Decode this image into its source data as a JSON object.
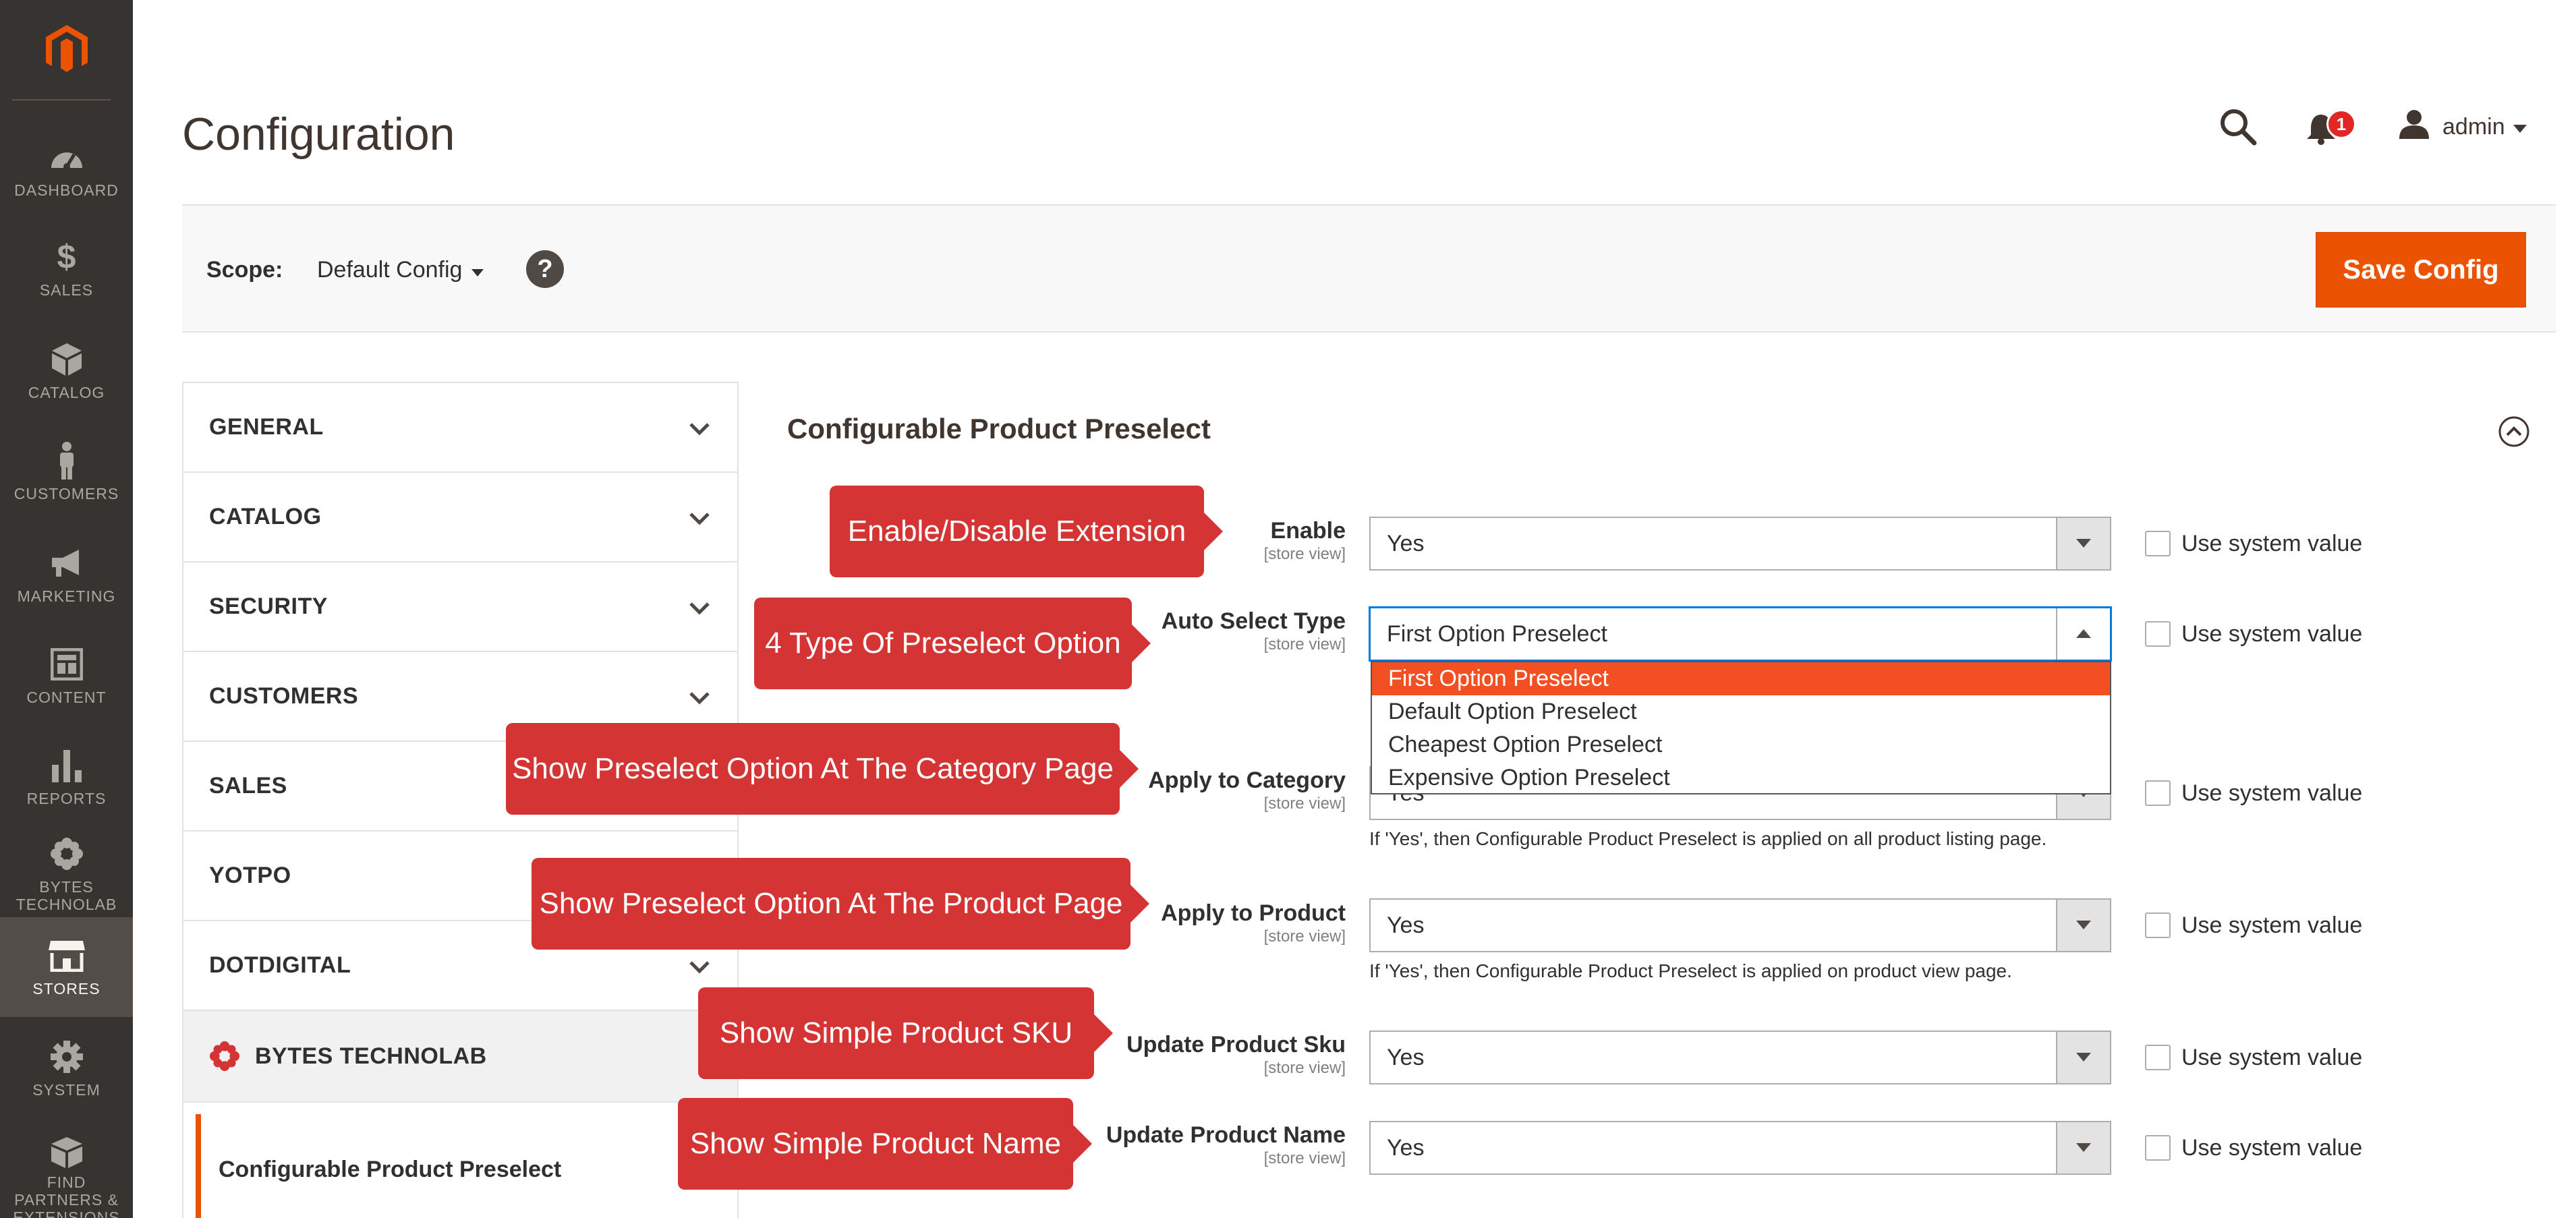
{
  "brand": {
    "accent": "#eb5202",
    "menu_bg": "#373330",
    "callout_color": "#d43434"
  },
  "menu": {
    "items": [
      {
        "label": "DASHBOARD",
        "icon": "dashboard-icon"
      },
      {
        "label": "SALES",
        "icon": "dollar-icon"
      },
      {
        "label": "CATALOG",
        "icon": "box-icon"
      },
      {
        "label": "CUSTOMERS",
        "icon": "person-icon"
      },
      {
        "label": "MARKETING",
        "icon": "megaphone-icon"
      },
      {
        "label": "CONTENT",
        "icon": "layout-icon"
      },
      {
        "label": "REPORTS",
        "icon": "bar-chart-icon"
      },
      {
        "label": "BYTES TECHNOLAB",
        "icon": "gear-flower-icon"
      },
      {
        "label": "STORES",
        "icon": "store-icon",
        "active": true
      },
      {
        "label": "SYSTEM",
        "icon": "gear-icon"
      },
      {
        "label": "FIND PARTNERS & EXTENSIONS",
        "icon": "cubes-icon"
      }
    ]
  },
  "header": {
    "title": "Configuration",
    "notifications_count": "1",
    "user": "admin"
  },
  "scope": {
    "label": "Scope:",
    "value": "Default Config",
    "help": "?",
    "save_label": "Save Config"
  },
  "tabs": {
    "general": "GENERAL",
    "catalog": "CATALOG",
    "security": "SECURITY",
    "customers": "CUSTOMERS",
    "sales": "SALES",
    "yotpo": "YOTPO",
    "dotdigital": "DOTDIGITAL",
    "bytes": "BYTES TECHNOLAB",
    "bytes_sub": "Configurable Product Preselect"
  },
  "section": {
    "title": "Configurable Product Preselect",
    "scope_note": "[store view]",
    "use_system": "Use system value",
    "fields": {
      "enable": {
        "label": "Enable",
        "value": "Yes"
      },
      "auto_select": {
        "label": "Auto Select Type",
        "value": "First Option Preselect"
      },
      "apply_category": {
        "label": "Apply to Category",
        "value": "Yes",
        "note": "If 'Yes', then Configurable Product Preselect is applied on all product listing page."
      },
      "apply_product": {
        "label": "Apply to Product",
        "value": "Yes",
        "note": "If 'Yes', then Configurable Product Preselect is applied on product view page."
      },
      "update_sku": {
        "label": "Update Product Sku",
        "value": "Yes"
      },
      "update_name": {
        "label": "Update Product Name",
        "value": "Yes"
      }
    },
    "dropdown_options": [
      "First Option Preselect",
      "Default Option Preselect",
      "Cheapest Option Preselect",
      "Expensive Option Preselect"
    ]
  },
  "callouts": {
    "enable": "Enable/Disable Extension",
    "auto_select": "4 Type Of Preselect Option",
    "category": "Show Preselect Option At The Category Page",
    "product": "Show Preselect Option At The Product Page",
    "sku": "Show Simple Product SKU",
    "name": "Show Simple Product Name"
  }
}
